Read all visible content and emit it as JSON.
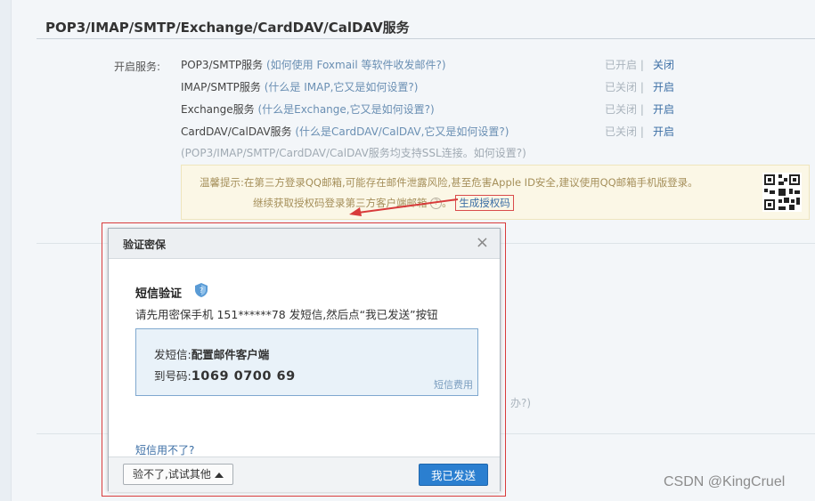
{
  "section": {
    "title": "POP3/IMAP/SMTP/Exchange/CardDAV/CalDAV服务",
    "label": "开启服务:"
  },
  "services": [
    {
      "name": "POP3/SMTP服务",
      "help": "(如何使用 Foxmail 等软件收发邮件?)",
      "status": "已开启 |",
      "action": "关闭"
    },
    {
      "name": "IMAP/SMTP服务",
      "help": "(什么是 IMAP,它又是如何设置?)",
      "status": "已关闭 |",
      "action": "开启"
    },
    {
      "name": "Exchange服务",
      "help": "(什么是Exchange,它又是如何设置?)",
      "status": "已关闭 |",
      "action": "开启"
    },
    {
      "name": "CardDAV/CalDAV服务",
      "help": "(什么是CardDAV/CalDAV,它又是如何设置?)",
      "status": "已关闭 |",
      "action": "开启"
    }
  ],
  "ssl_note": "(POP3/IMAP/SMTP/CardDAV/CalDAV服务均支持SSL连接。如何设置?)",
  "tip": {
    "line1": "温馨提示:在第三方登录QQ邮箱,可能存在邮件泄露风险,甚至危害Apple ID安全,建议使用QQ邮箱手机版登录。",
    "line2": "继续获取授权码登录第三方客户端邮箱",
    "help_glyph": "?",
    "line2_end": "。",
    "generate_link": "生成授权码"
  },
  "behind_text": "办?)",
  "dialog": {
    "title": "验证密保",
    "close": "×",
    "sms_title": "短信验证",
    "sms_desc": "请先用密保手机 151******78 发短信,然后点“我已发送”按钮",
    "send_label": "发短信:",
    "send_content": "配置邮件客户端",
    "to_label": "到号码:",
    "to_number": "1069 0700 69",
    "fee_link": "短信费用",
    "cant_use": "短信用不了?",
    "other_button": "验不了,试试其他",
    "sent_button": "我已发送"
  },
  "watermark": "CSDN @KingCruel"
}
